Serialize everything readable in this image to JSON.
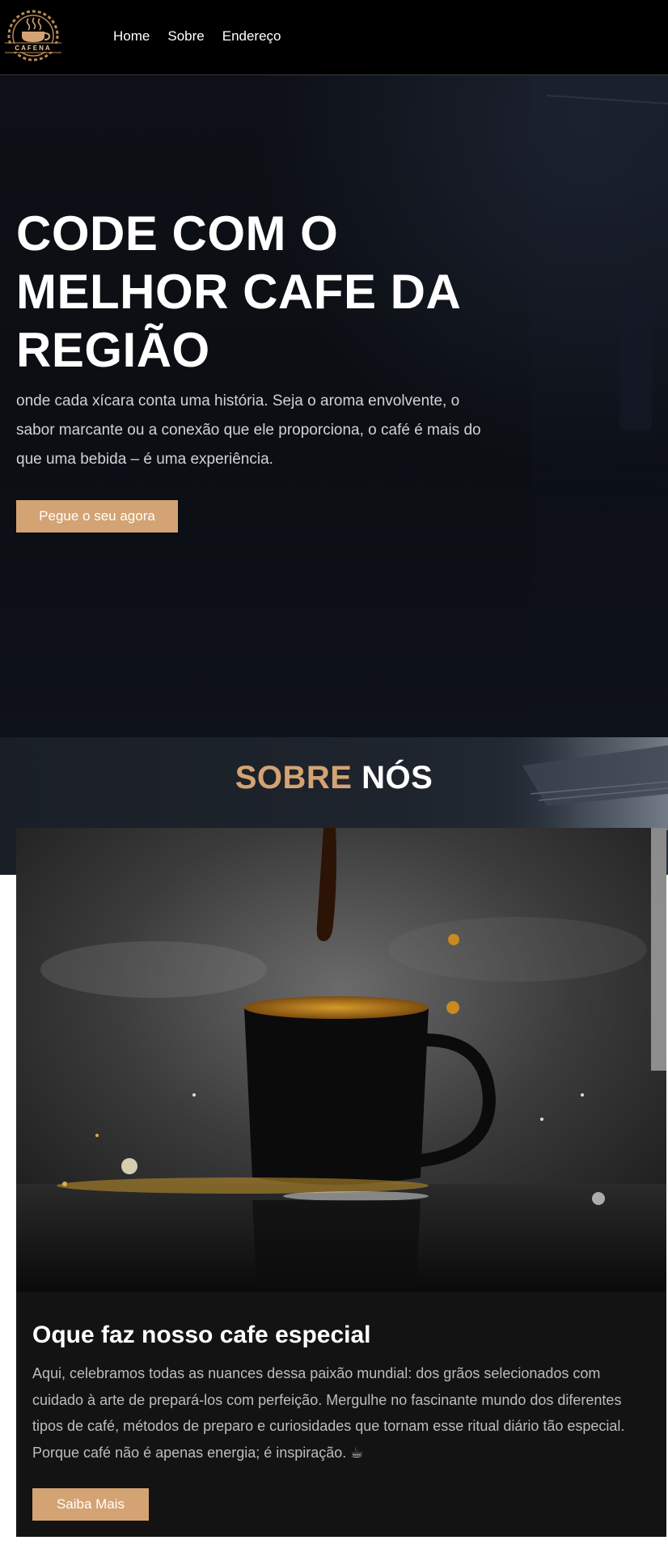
{
  "brand": {
    "logo_text": "CAFENA"
  },
  "nav": {
    "links": [
      "Home",
      "Sobre",
      "Endereço"
    ]
  },
  "hero": {
    "title": "CODE COM O MELHOR CAFE DA REGIÃO",
    "text": "onde cada xícara conta uma história. Seja o aroma envolvente, o sabor marcante ou a conexão que ele proporciona, o café é mais do que uma bebida – é uma experiência.",
    "button_label": "Pegue o seu agora"
  },
  "about": {
    "title_highlight": "SOBRE",
    "title_rest": "NÓS",
    "card": {
      "title": "Oque faz nosso cafe especial",
      "text": "Aqui, celebramos todas as nuances dessa paixão mundial: dos grãos selecionados com cuidado à arte de prepará-los com perfeição. Mergulhe no fascinante mundo dos diferentes tipos de café, métodos de preparo e curiosidades que tornam esse ritual diário tão especial. Porque café não é apenas energia; é inspiração. ☕",
      "button_label": "Saiba Mais"
    }
  },
  "colors": {
    "accent": "#d4a373",
    "navbar": "#000000",
    "hero_bg": "#0d1016",
    "card_bg": "#131313"
  }
}
